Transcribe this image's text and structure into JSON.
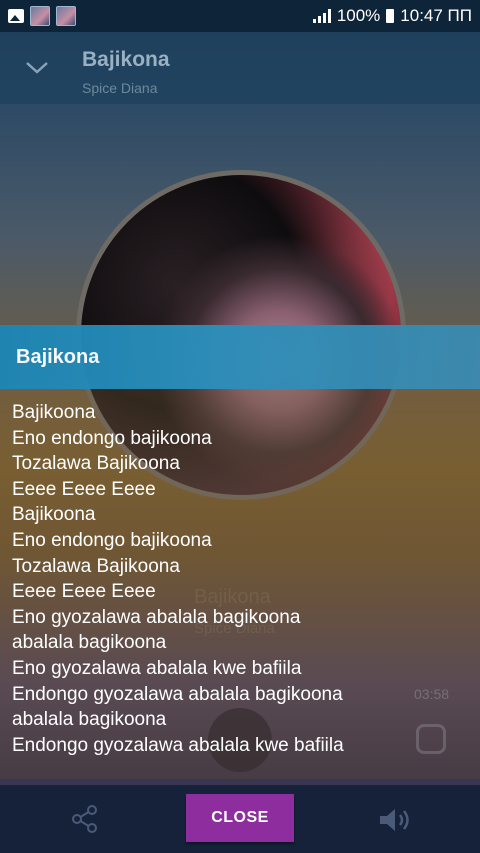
{
  "status_bar": {
    "battery": "100%",
    "time": "10:47 ПП",
    "icons": [
      "image-icon",
      "thumbnail-icon",
      "thumbnail-icon",
      "signal-icon"
    ]
  },
  "player": {
    "title": "Bajikona",
    "artist": "Spice Diana",
    "time_total": "03:58"
  },
  "lyrics_dialog": {
    "title": "Bajikona",
    "lines": [
      "Bajikoona",
      "Eno endongo bajikoona",
      "Tozalawa Bajikoona",
      "Eeee Eeee Eeee",
      "Bajikoona",
      "Eno endongo bajikoona",
      "Tozalawa Bajikoona",
      "Eeee Eeee Eeee",
      "Eno gyozalawa abalala bagikoona",
      "abalala bagikoona",
      "Eno gyozalawa abalala kwe bafiila",
      "Endongo gyozalawa abalala bagikoona",
      "abalala bagikoona",
      "Endongo gyozalawa abalala kwe bafiila"
    ],
    "close_label": "CLOSE"
  },
  "colors": {
    "accent": "#8e2e9e",
    "dialog_header": "#1d86b6"
  }
}
